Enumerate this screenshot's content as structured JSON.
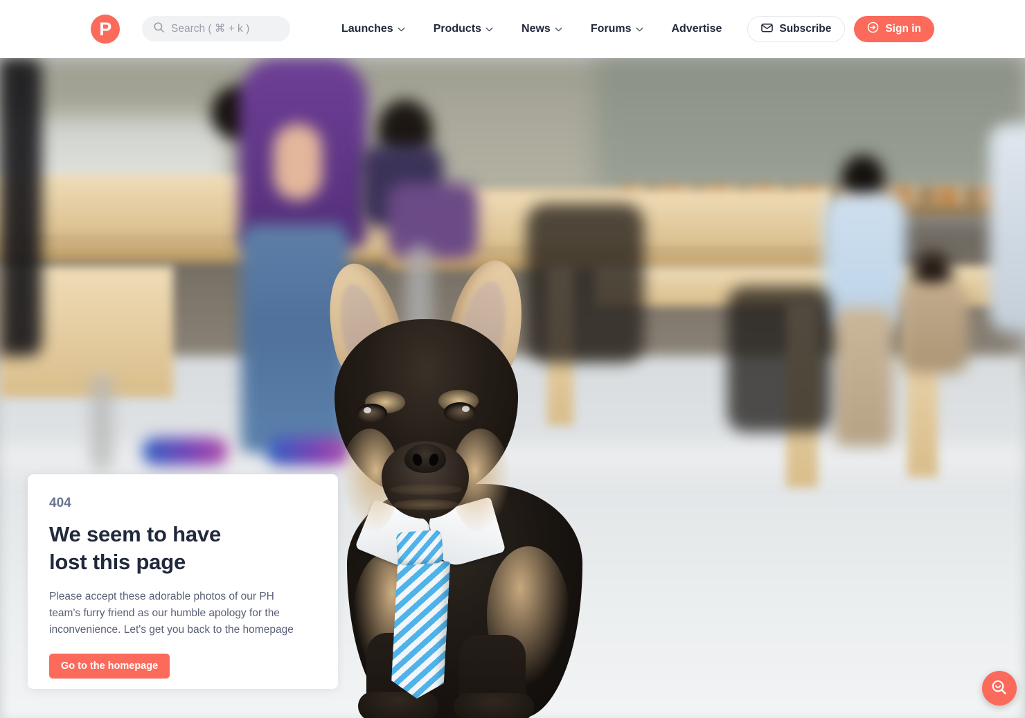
{
  "header": {
    "logo_letter": "P",
    "search": {
      "placeholder": "Search ( ⌘ + k )",
      "value": ""
    },
    "nav": [
      {
        "label": "Launches",
        "has_chevron": true
      },
      {
        "label": "Products",
        "has_chevron": true
      },
      {
        "label": "News",
        "has_chevron": true
      },
      {
        "label": "Forums",
        "has_chevron": true
      },
      {
        "label": "Advertise",
        "has_chevron": false
      }
    ],
    "subscribe_label": "Subscribe",
    "signin_label": "Sign in"
  },
  "error_card": {
    "code": "404",
    "headline_line1": "We seem to have",
    "headline_line2": "lost this page",
    "blurb": "Please accept these adorable photos of our PH team's furry friend as our humble apology for the inconvenience. Let's get you back to the homepage",
    "cta_label": "Go to the homepage"
  },
  "colors": {
    "accent": "#fb6a5b",
    "text_dark": "#21293c",
    "text_muted": "#596077",
    "code_muted": "#6b7490",
    "search_bg": "#f1f2f4",
    "card_bg": "#ffffff"
  },
  "icons": {
    "search": "search-icon",
    "chevron": "chevron-down-icon",
    "subscribe": "envelope-icon",
    "signin": "sign-in-arrow-icon",
    "fab": "search-smile-icon"
  },
  "hero_image": {
    "alt": "Blurred Apple-store interior with a French bulldog wearing a white collar and blue striped tie sitting in the foreground"
  }
}
